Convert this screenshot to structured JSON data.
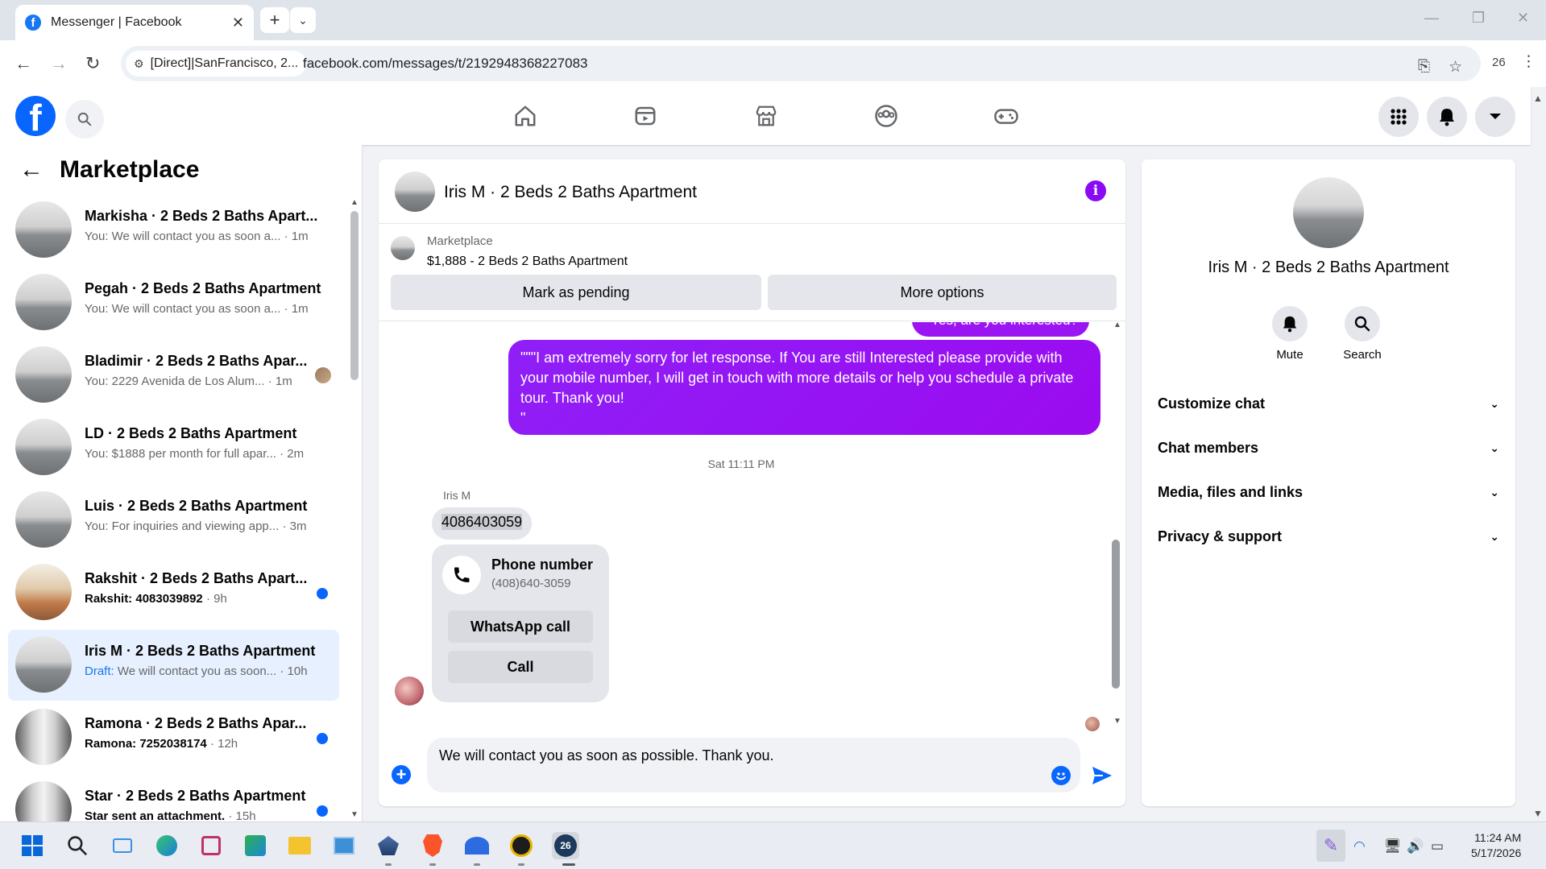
{
  "browser": {
    "tab_title": "Messenger | Facebook",
    "new_tab": "+",
    "site_chip": "[Direct]|SanFrancisco, 2...",
    "url": "facebook.com/messages/t/2192948368227083",
    "profile_count": "26"
  },
  "sidebar": {
    "title": "Marketplace",
    "conversations": [
      {
        "name": "Markisha · 2 Beds 2 Baths Apart...",
        "preview": "You: We will contact you as soon a...",
        "time": "· 1m"
      },
      {
        "name": "Pegah · 2 Beds 2 Baths Apartment",
        "preview": "You: We will contact you as soon a...",
        "time": "· 1m"
      },
      {
        "name": "Bladimir · 2 Beds 2 Baths Apar...",
        "preview": "You: 2229 Avenida de Los Alum...",
        "time": "· 1m"
      },
      {
        "name": "LD · 2 Beds 2 Baths Apartment",
        "preview": "You: $1888 per month for full apar...",
        "time": "· 2m"
      },
      {
        "name": "Luis · 2 Beds 2 Baths Apartment",
        "preview": "You: For inquiries and viewing app...",
        "time": "· 3m"
      },
      {
        "name": "Rakshit · 2 Beds 2 Baths Apart...",
        "preview": "Rakshit: 4083039892",
        "time": "· 9h"
      },
      {
        "name": "Iris M · 2 Beds 2 Baths Apartment",
        "draft_label": "Draft:",
        "preview": " We will contact you as soon...",
        "time": "· 10h"
      },
      {
        "name": "Ramona · 2 Beds 2 Baths Apar...",
        "preview": "Ramona: 7252038174",
        "time": "· 12h"
      },
      {
        "name": "Star · 2 Beds 2 Baths Apartment",
        "preview": "Star sent an attachment.",
        "time": "· 15h"
      }
    ]
  },
  "chat": {
    "title": "Iris M · 2 Beds 2 Baths Apartment",
    "info_icon": "i",
    "listing_label": "Marketplace",
    "listing_title": "$1,888 - 2 Beds 2 Baths Apartment",
    "mark_pending": "Mark as pending",
    "more_options": "More options",
    "partial_message": "Yes, are you interested?",
    "sent_message": "\"\"\"I am extremely sorry for let response. If You are still Interested please provide with your mobile number, I will get in touch with more details or help you schedule a private tour. Thank you!\n\"",
    "timestamp": "Sat 11:11 PM",
    "sender": "Iris M",
    "phone_message": "4086403059",
    "phone_card_title": "Phone number",
    "phone_card_number": "(408)640-3059",
    "whatsapp_call": "WhatsApp call",
    "call": "Call",
    "composer_text": "We will contact you as soon as possible. Thank you."
  },
  "info_panel": {
    "name": "Iris M · 2 Beds 2 Baths Apartment",
    "mute": "Mute",
    "search": "Search",
    "sections": [
      "Customize chat",
      "Chat members",
      "Media, files and links",
      "Privacy & support"
    ]
  },
  "taskbar": {
    "time": "11:24 AM",
    "date": "5/17/2026"
  },
  "colors": {
    "facebook_blue": "#0866ff",
    "message_purple": "#9b0bf0",
    "unread_dot": "#0866ff"
  }
}
